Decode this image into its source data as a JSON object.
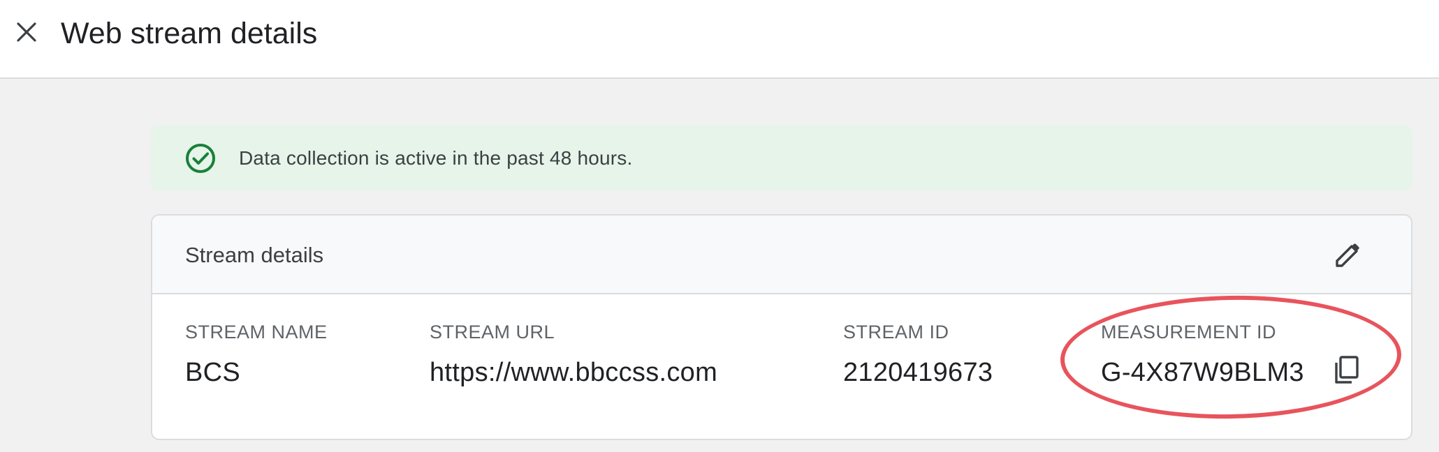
{
  "header": {
    "title": "Web stream details",
    "close_icon": "close-icon"
  },
  "banner": {
    "text": "Data collection is active in the past 48 hours.",
    "icon": "check-circle-icon",
    "color": "#188038"
  },
  "stream_details": {
    "title": "Stream details",
    "edit_icon": "pencil-icon",
    "fields": [
      {
        "label": "STREAM NAME",
        "value": "BCS"
      },
      {
        "label": "STREAM URL",
        "value": "https://www.bbccss.com"
      },
      {
        "label": "STREAM ID",
        "value": "2120419673"
      },
      {
        "label": "MEASUREMENT ID",
        "value": "G-4X87W9BLM3"
      }
    ],
    "copy_icon": "copy-icon"
  },
  "annotation": {
    "highlight_color": "#e8545c"
  }
}
